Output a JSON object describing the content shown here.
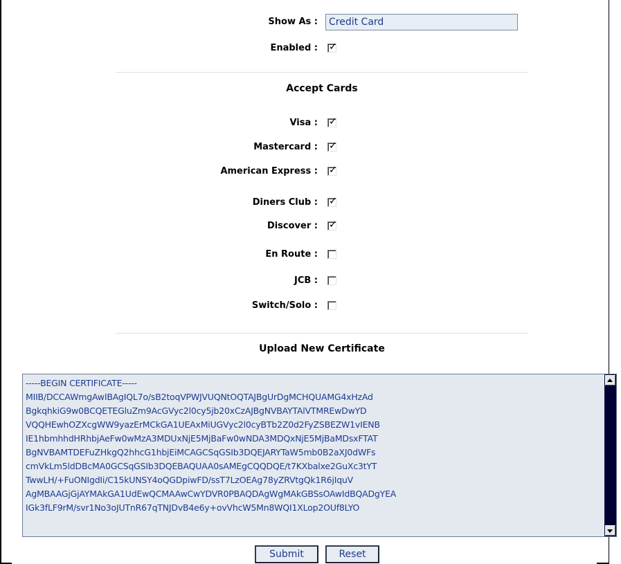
{
  "settings": {
    "show_as_label": "Show As :",
    "show_as_value": "Credit Card",
    "enabled_label": "Enabled :",
    "enabled_checked": true
  },
  "accept_cards": {
    "title": "Accept Cards",
    "cards": [
      {
        "label": "Visa :",
        "checked": true
      },
      {
        "label": "Mastercard :",
        "checked": true
      },
      {
        "label": "American Express :",
        "checked": true
      },
      {
        "label": "Diners Club :",
        "checked": true
      },
      {
        "label": "Discover :",
        "checked": true
      },
      {
        "label": "En Route :",
        "checked": false
      },
      {
        "label": "JCB :",
        "checked": false
      },
      {
        "label": "Switch/Solo :",
        "checked": false
      }
    ]
  },
  "certificate": {
    "title": "Upload New Certificate",
    "text": "-----BEGIN CERTIFICATE-----\nMIIB/DCCAWmgAwIBAgIQL7o/sB2toqVPWJVUQNtOQTAJBgUrDgMCHQUAMG4xHzAd\nBgkqhkiG9w0BCQETEGluZm9AcGVyc2l0cy5jb20xCzAJBgNVBAYTAlVTMREwDwYD\nVQQHEwhOZXcgWW9yazErMCkGA1UEAxMiUGVyc2l0cyBTb2Z0d2FyZSBEZW1vIENB\nIE1hbmhhdHRhbjAeFw0wMzA3MDUxNjE5MjBaFw0wNDA3MDQxNjE5MjBaMDsxFTAT\nBgNVBAMTDEFuZHkgQ2hhcG1hbjEiMCAGCSqGSIb3DQEJARYTaW5mb0B2aXJ0dWFs\ncmVkLm5ldDBcMA0GCSqGSIb3DQEBAQUAA0sAMEgCQQDQE/t7KXbalxe2GuXc3tYT\nTwwLH/+FuONIgdIi/C15kUNSY4oQGDpiwFD/ssT7LzOEAg78yZRVtgQk1R6jIquV\nAgMBAAGjGjAYMAkGA1UdEwQCMAAwCwYDVR0PBAQDAgWgMAkGBSsOAwIdBQADgYEA\nIGk3fLF9rM/svr1No3oJUTnR67qTNJDvB4e6y+ovVhcW5Mn8WQI1XLop2OUf8LYO"
  },
  "buttons": {
    "submit": "Submit",
    "reset": "Reset"
  }
}
